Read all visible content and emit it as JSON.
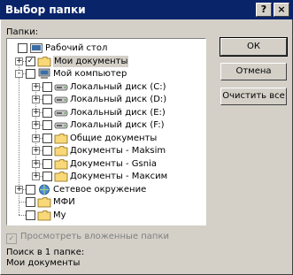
{
  "window": {
    "title": "Выбор папки",
    "help_button": "?",
    "close_button": "×"
  },
  "folders_label": "Папки:",
  "tree": [
    {
      "label": "Рабочий стол",
      "level": 0,
      "checked": false,
      "icon": "desktop-icon",
      "expander": ""
    },
    {
      "label": "Мои документы",
      "level": 1,
      "checked": true,
      "icon": "folder-icon",
      "expander": "+",
      "selected": true
    },
    {
      "label": "Мой компьютер",
      "level": 1,
      "checked": false,
      "icon": "computer-icon",
      "expander": "-"
    },
    {
      "label": "Локальный диск (C:)",
      "level": 2,
      "checked": false,
      "icon": "drive-icon",
      "expander": "+"
    },
    {
      "label": "Локальный диск (D:)",
      "level": 2,
      "checked": false,
      "icon": "drive-icon",
      "expander": "+"
    },
    {
      "label": "Локальный диск (E:)",
      "level": 2,
      "checked": false,
      "icon": "drive-icon",
      "expander": "+"
    },
    {
      "label": "Локальный диск (F:)",
      "level": 2,
      "checked": false,
      "icon": "drive-icon",
      "expander": "+"
    },
    {
      "label": "Общие документы",
      "level": 2,
      "checked": false,
      "icon": "folder-icon",
      "expander": "+"
    },
    {
      "label": "Документы - Maksim",
      "level": 2,
      "checked": false,
      "icon": "folder-icon",
      "expander": "+"
    },
    {
      "label": "Документы - Gsnia",
      "level": 2,
      "checked": false,
      "icon": "folder-icon",
      "expander": "+"
    },
    {
      "label": "Документы - Максим",
      "level": 2,
      "checked": false,
      "icon": "folder-icon",
      "expander": "+"
    },
    {
      "label": "Сетевое окружение",
      "level": 1,
      "checked": false,
      "icon": "network-icon",
      "expander": "+"
    },
    {
      "label": "МФИ",
      "level": 1,
      "checked": false,
      "icon": "folder-icon",
      "expander": ""
    },
    {
      "label": "My",
      "level": 1,
      "checked": false,
      "icon": "folder-icon",
      "expander": ""
    }
  ],
  "buttons": {
    "ok": "ОК",
    "cancel": "Отмена",
    "clear_all": "Очистить все"
  },
  "subfolders_checkbox": "Просмотреть вложенные папки",
  "search_in_label": "Поиск в 1 папке:",
  "search_in_value": "Мои документы",
  "colors": {
    "title_bar": "#0a246a",
    "face": "#d4d0c8",
    "folder": "#f8d878"
  }
}
